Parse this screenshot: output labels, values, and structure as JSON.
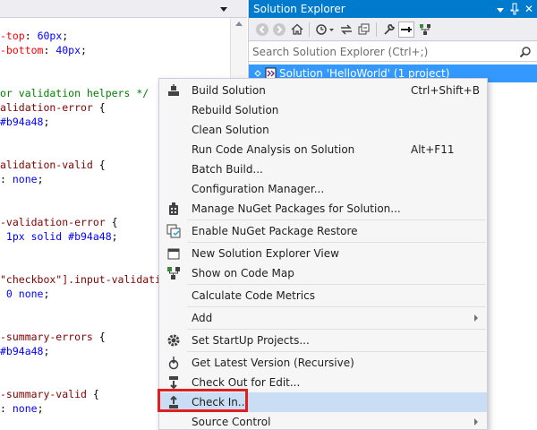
{
  "editor": {
    "lines": [
      {
        "parts": [
          {
            "t": "-top",
            "c": "c-prop"
          },
          {
            "t": ": ",
            "c": "c-pun"
          },
          {
            "t": "60px",
            "c": "c-val"
          },
          {
            "t": ";",
            "c": "c-pun"
          }
        ]
      },
      {
        "parts": [
          {
            "t": "-bottom",
            "c": "c-prop"
          },
          {
            "t": ": ",
            "c": "c-pun"
          },
          {
            "t": "40px",
            "c": "c-val"
          },
          {
            "t": ";",
            "c": "c-pun"
          }
        ]
      },
      {
        "parts": [
          {
            "t": "or validation helpers */",
            "c": "c-cmt"
          }
        ]
      },
      {
        "parts": [
          {
            "t": "alidation-error",
            "c": "c-sel"
          },
          {
            "t": " {",
            "c": "c-pun"
          }
        ]
      },
      {
        "parts": [
          {
            "t": "#b94a48",
            "c": "c-val"
          },
          {
            "t": ";",
            "c": "c-pun"
          }
        ]
      },
      {
        "parts": [
          {
            "t": "alidation-valid",
            "c": "c-sel"
          },
          {
            "t": " {",
            "c": "c-pun"
          }
        ]
      },
      {
        "parts": [
          {
            "t": ": ",
            "c": "c-pun"
          },
          {
            "t": "none",
            "c": "c-val"
          },
          {
            "t": ";",
            "c": "c-pun"
          }
        ]
      },
      {
        "parts": [
          {
            "t": "-validation-error",
            "c": "c-sel"
          },
          {
            "t": " {",
            "c": "c-pun"
          }
        ]
      },
      {
        "parts": [
          {
            "t": " 1px solid #b94a48",
            "c": "c-val"
          },
          {
            "t": ";",
            "c": "c-pun"
          }
        ]
      },
      {
        "parts": [
          {
            "t": "\"checkbox\"].input-validati",
            "c": "c-sel"
          }
        ]
      },
      {
        "parts": [
          {
            "t": " 0 none",
            "c": "c-val"
          },
          {
            "t": ";",
            "c": "c-pun"
          }
        ]
      },
      {
        "parts": [
          {
            "t": "-summary-errors",
            "c": "c-sel"
          },
          {
            "t": " {",
            "c": "c-pun"
          }
        ]
      },
      {
        "parts": [
          {
            "t": "#b94a48",
            "c": "c-val"
          },
          {
            "t": ";",
            "c": "c-pun"
          }
        ]
      },
      {
        "parts": [
          {
            "t": "-summary-valid",
            "c": "c-sel"
          },
          {
            "t": " {",
            "c": "c-pun"
          }
        ]
      },
      {
        "parts": [
          {
            "t": ": ",
            "c": "c-pun"
          },
          {
            "t": "none",
            "c": "c-val"
          },
          {
            "t": ";",
            "c": "c-pun"
          }
        ]
      }
    ]
  },
  "solution_explorer": {
    "title": "Solution Explorer",
    "search_placeholder": "Search Solution Explorer (Ctrl+;)",
    "solution_label": "Solution 'HelloWorld' (1 project)",
    "toolbar_icons": [
      "back-icon",
      "forward-icon",
      "home-icon",
      "history-icon",
      "sync-icon",
      "collapse-all-icon",
      "properties-icon",
      "preview-icon",
      "code-map-icon"
    ]
  },
  "context_menu": {
    "items": [
      {
        "label": "Build Solution",
        "shortcut": "Ctrl+Shift+B",
        "icon": "build-icon"
      },
      {
        "label": "Rebuild Solution"
      },
      {
        "label": "Clean Solution"
      },
      {
        "label": "Run Code Analysis on Solution",
        "shortcut": "Alt+F11"
      },
      {
        "label": "Batch Build..."
      },
      {
        "label": "Configuration Manager..."
      },
      {
        "label": "Manage NuGet Packages for Solution...",
        "icon": "nuget-icon"
      },
      {
        "label": "Enable NuGet Package Restore",
        "icon": "package-restore-icon"
      },
      {
        "label": "New Solution Explorer View",
        "icon": "new-view-icon"
      },
      {
        "label": "Show on Code Map",
        "icon": "code-map-icon"
      },
      {
        "label": "Calculate Code Metrics"
      },
      {
        "label": "Add",
        "submenu": true
      },
      {
        "label": "Set StartUp Projects...",
        "icon": "gear-icon"
      },
      {
        "label": "Get Latest Version (Recursive)",
        "icon": "get-latest-icon"
      },
      {
        "label": "Check Out for Edit...",
        "icon": "check-out-icon"
      },
      {
        "label": "Check In...",
        "icon": "check-in-icon",
        "highlighted": true
      },
      {
        "label": "Source Control",
        "submenu": true
      }
    ]
  },
  "colors": {
    "accent": "#007acc",
    "selection": "#3399ff",
    "menu_hover": "#c9def5",
    "callout_border": "#e02020"
  }
}
